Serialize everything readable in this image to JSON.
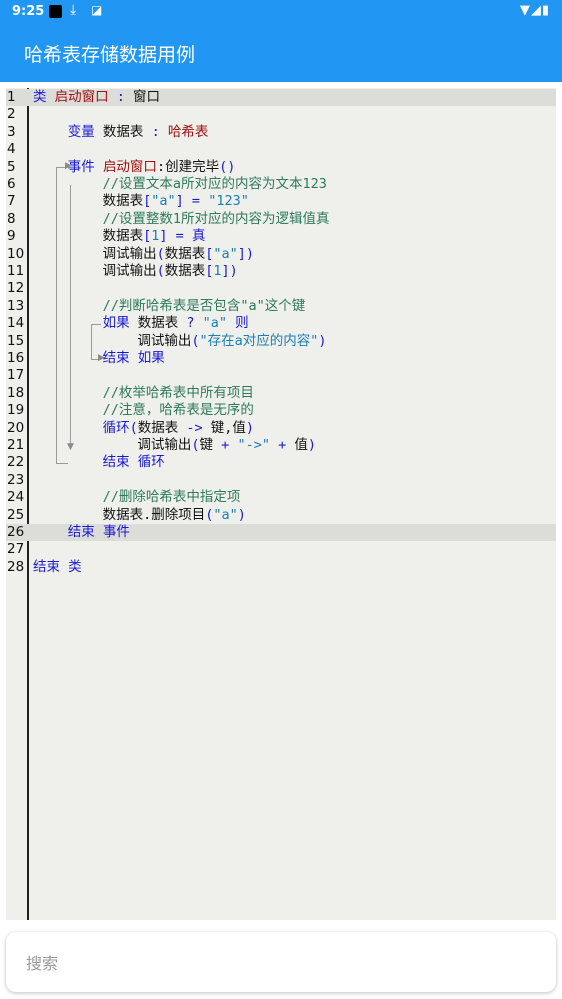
{
  "status_bar": {
    "time": "9:25",
    "icons": [
      "app-square-icon",
      "download-icon",
      "notification-a-icon",
      "wifi-icon",
      "signal-icon",
      "battery-icon"
    ]
  },
  "app_bar": {
    "title": "哈希表存储数据用例"
  },
  "editor": {
    "lines": [
      {
        "n": "1",
        "indent": 0,
        "tokens": [
          [
            "kw",
            "类"
          ],
          [
            "pl",
            " "
          ],
          [
            "ty",
            "启动窗口"
          ],
          [
            "pl",
            " "
          ],
          [
            "kw",
            ":"
          ],
          [
            "pl",
            " 窗口"
          ]
        ]
      },
      {
        "n": "2",
        "indent": 0,
        "tokens": []
      },
      {
        "n": "3",
        "indent": 4,
        "tokens": [
          [
            "kw",
            "变量"
          ],
          [
            "pl",
            " 数据表 "
          ],
          [
            "kw",
            ":"
          ],
          [
            "pl",
            " "
          ],
          [
            "ty",
            "哈希表"
          ]
        ]
      },
      {
        "n": "4",
        "indent": 0,
        "tokens": []
      },
      {
        "n": "5",
        "indent": 4,
        "tokens": [
          [
            "kw",
            "事件"
          ],
          [
            "pl",
            " "
          ],
          [
            "ty",
            "启动窗口"
          ],
          [
            "pl",
            ":创建完毕"
          ],
          [
            "pu",
            "()"
          ]
        ]
      },
      {
        "n": "6",
        "indent": 8,
        "tokens": [
          [
            "cm",
            "//设置文本a所对应的内容为文本123"
          ]
        ]
      },
      {
        "n": "7",
        "indent": 8,
        "tokens": [
          [
            "pl",
            "数据表"
          ],
          [
            "pu",
            "["
          ],
          [
            "st",
            "\"a\""
          ],
          [
            "pu",
            "]"
          ],
          [
            "pl",
            " "
          ],
          [
            "pu",
            "="
          ],
          [
            "pl",
            " "
          ],
          [
            "st",
            "\"123\""
          ]
        ]
      },
      {
        "n": "8",
        "indent": 8,
        "tokens": [
          [
            "cm",
            "//设置整数1所对应的内容为逻辑值真"
          ]
        ]
      },
      {
        "n": "9",
        "indent": 8,
        "tokens": [
          [
            "pl",
            "数据表"
          ],
          [
            "pu",
            "["
          ],
          [
            "st",
            "1"
          ],
          [
            "pu",
            "]"
          ],
          [
            "pl",
            " "
          ],
          [
            "pu",
            "="
          ],
          [
            "pl",
            " "
          ],
          [
            "kw",
            "真"
          ]
        ]
      },
      {
        "n": "10",
        "indent": 8,
        "tokens": [
          [
            "pl",
            "调试输出"
          ],
          [
            "pu",
            "("
          ],
          [
            "pl",
            "数据表"
          ],
          [
            "pu",
            "["
          ],
          [
            "st",
            "\"a\""
          ],
          [
            "pu",
            "])"
          ]
        ]
      },
      {
        "n": "11",
        "indent": 8,
        "tokens": [
          [
            "pl",
            "调试输出"
          ],
          [
            "pu",
            "("
          ],
          [
            "pl",
            "数据表"
          ],
          [
            "pu",
            "["
          ],
          [
            "st",
            "1"
          ],
          [
            "pu",
            "])"
          ]
        ]
      },
      {
        "n": "12",
        "indent": 0,
        "tokens": []
      },
      {
        "n": "13",
        "indent": 8,
        "tokens": [
          [
            "cm",
            "//判断哈希表是否包含\"a\"这个键"
          ]
        ]
      },
      {
        "n": "14",
        "indent": 8,
        "tokens": [
          [
            "kw",
            "如果"
          ],
          [
            "pl",
            " 数据表 "
          ],
          [
            "kw",
            "?"
          ],
          [
            "pl",
            " "
          ],
          [
            "st",
            "\"a\""
          ],
          [
            "pl",
            " "
          ],
          [
            "kw",
            "则"
          ]
        ]
      },
      {
        "n": "15",
        "indent": 12,
        "tokens": [
          [
            "pl",
            "调试输出"
          ],
          [
            "pu",
            "("
          ],
          [
            "st",
            "\"存在a对应的内容\""
          ],
          [
            "pu",
            ")"
          ]
        ]
      },
      {
        "n": "16",
        "indent": 8,
        "tokens": [
          [
            "kw",
            "结束"
          ],
          [
            "pl",
            " "
          ],
          [
            "kw",
            "如果"
          ]
        ]
      },
      {
        "n": "17",
        "indent": 0,
        "tokens": []
      },
      {
        "n": "18",
        "indent": 8,
        "tokens": [
          [
            "cm",
            "//枚举哈希表中所有项目"
          ]
        ]
      },
      {
        "n": "19",
        "indent": 8,
        "tokens": [
          [
            "cm",
            "//注意，哈希表是无序的"
          ]
        ]
      },
      {
        "n": "20",
        "indent": 8,
        "tokens": [
          [
            "kw",
            "循环"
          ],
          [
            "pu",
            "("
          ],
          [
            "pl",
            "数据表 "
          ],
          [
            "kw",
            "->"
          ],
          [
            "pl",
            " 键,值"
          ],
          [
            "pu",
            ")"
          ]
        ]
      },
      {
        "n": "21",
        "indent": 12,
        "tokens": [
          [
            "pl",
            "调试输出"
          ],
          [
            "pu",
            "("
          ],
          [
            "pl",
            "键 "
          ],
          [
            "pu",
            "+"
          ],
          [
            "pl",
            " "
          ],
          [
            "st",
            "\"->\""
          ],
          [
            "pl",
            " "
          ],
          [
            "pu",
            "+"
          ],
          [
            "pl",
            " 值"
          ],
          [
            "pu",
            ")"
          ]
        ]
      },
      {
        "n": "22",
        "indent": 8,
        "tokens": [
          [
            "kw",
            "结束"
          ],
          [
            "pl",
            " "
          ],
          [
            "kw",
            "循环"
          ]
        ]
      },
      {
        "n": "23",
        "indent": 0,
        "tokens": []
      },
      {
        "n": "24",
        "indent": 8,
        "tokens": [
          [
            "cm",
            "//删除哈希表中指定项"
          ]
        ]
      },
      {
        "n": "25",
        "indent": 8,
        "tokens": [
          [
            "pl",
            "数据表.删除项目"
          ],
          [
            "pu",
            "("
          ],
          [
            "st",
            "\"a\""
          ],
          [
            "pu",
            ")"
          ]
        ]
      },
      {
        "n": "26",
        "indent": 4,
        "tokens": [
          [
            "kw",
            "结束"
          ],
          [
            "pl",
            " "
          ],
          [
            "kw",
            "事件"
          ]
        ]
      },
      {
        "n": "27",
        "indent": 0,
        "tokens": []
      },
      {
        "n": "28",
        "indent": 0,
        "tokens": [
          [
            "kw",
            "结束"
          ],
          [
            "pl",
            " "
          ],
          [
            "kw",
            "类"
          ]
        ]
      }
    ],
    "highlighted_lines": [
      "1",
      "26"
    ]
  },
  "search": {
    "placeholder": "搜索",
    "value": ""
  }
}
